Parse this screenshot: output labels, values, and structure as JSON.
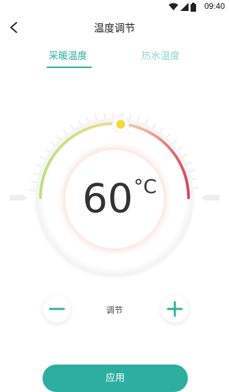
{
  "status_bar": {
    "time": "09:40",
    "icons": [
      "wifi-icon",
      "signal-icon",
      "battery-icon"
    ]
  },
  "header": {
    "title": "温度调节",
    "back_icon": "chevron-left-icon"
  },
  "tabs": [
    {
      "label": "采暖温度",
      "active": true
    },
    {
      "label": "热水温度",
      "active": false
    }
  ],
  "dial": {
    "temperature": "60",
    "unit": "°C",
    "knob_color": "#f5d63d",
    "arc_colors": [
      "#b9e07a",
      "#f0b6a0",
      "#d8435a"
    ]
  },
  "controls": {
    "minus_icon": "minus-icon",
    "plus_icon": "plus-icon",
    "label": "调节"
  },
  "actions": {
    "apply_label": "应用"
  },
  "colors": {
    "accent": "#2eaea0",
    "accent_light": "#8fd5cd"
  }
}
